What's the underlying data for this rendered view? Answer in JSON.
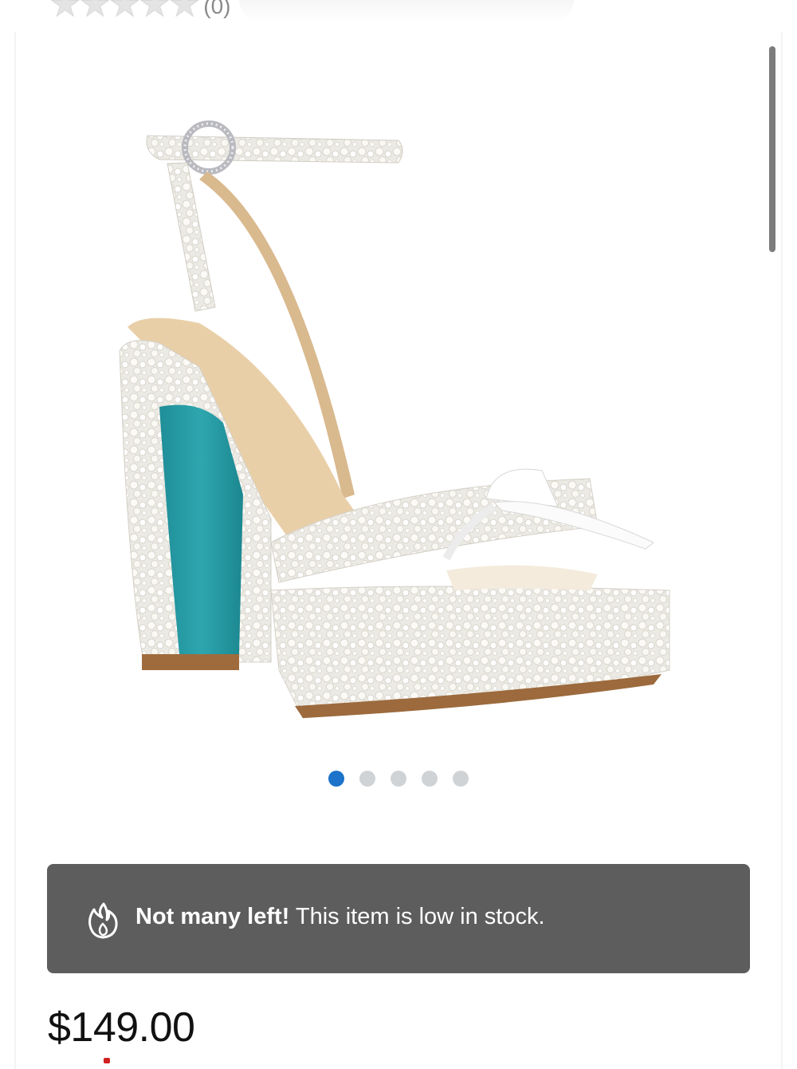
{
  "rating": {
    "stars": 5,
    "filled": 0,
    "count_text": "(0)"
  },
  "gallery": {
    "image_alt": "white pearl-embellished platform sandal with teal heel",
    "slide_count": 5,
    "active_slide": 1
  },
  "stock": {
    "icon": "flame-icon",
    "strong": "Not many left!",
    "message": "This item is low in stock."
  },
  "price": "$149.00",
  "colors": {
    "dot_active": "#1c73c9",
    "dot_inactive": "#d0d3d6",
    "banner": "#5d5d5d",
    "heel": "#2a9aa3"
  }
}
